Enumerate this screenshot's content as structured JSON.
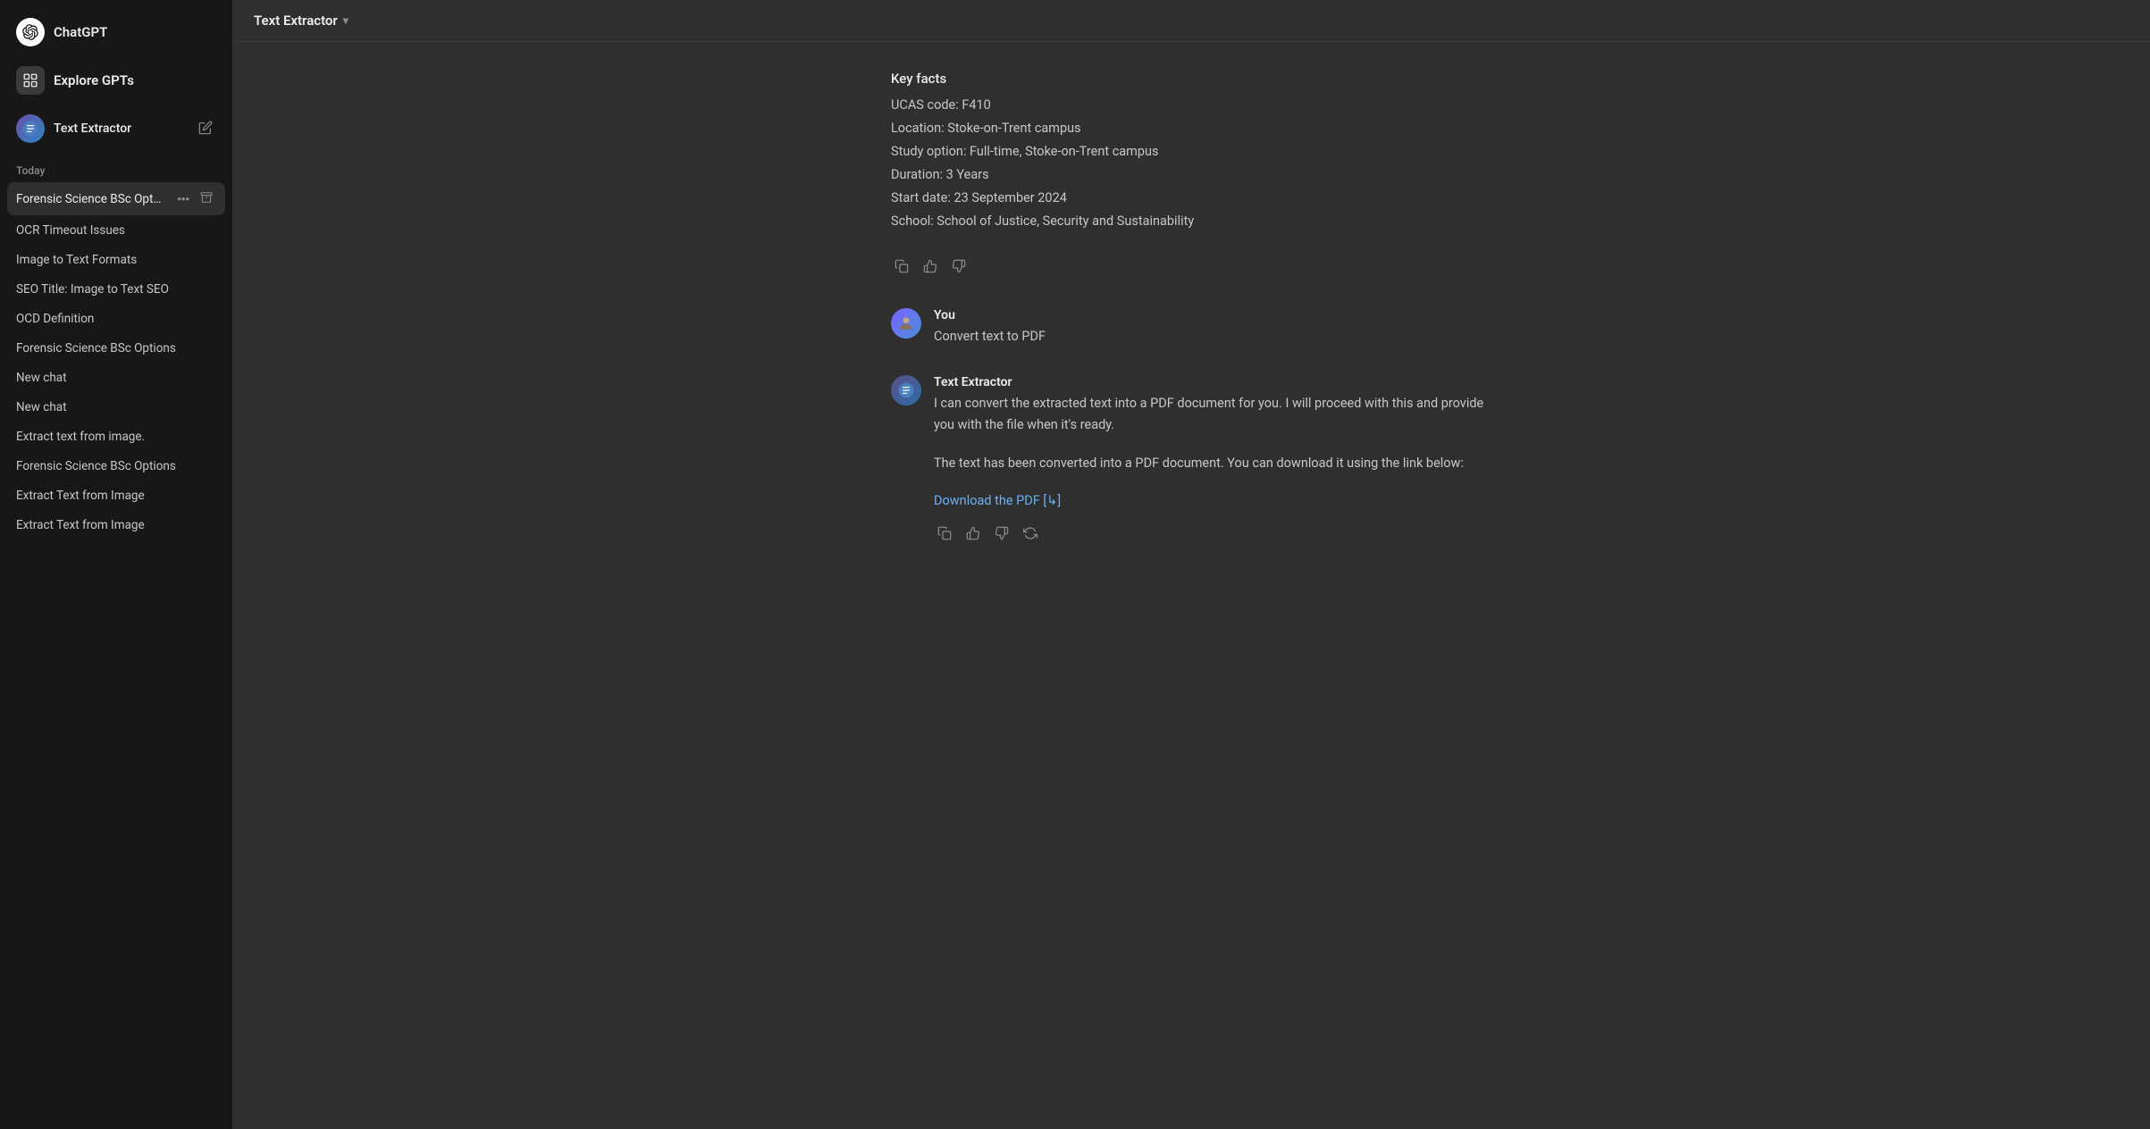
{
  "sidebar": {
    "app_name": "ChatGPT",
    "gpt_label": "Explore GPTs",
    "text_extractor_name": "Text Extractor",
    "edit_icon": "✏",
    "section_today": "Today",
    "chat_items": [
      {
        "id": "forensic-active",
        "label": "Forensic Science BSc Opt…",
        "active": true,
        "show_actions": true
      },
      {
        "id": "ocr-timeout",
        "label": "OCR Timeout Issues",
        "active": false,
        "show_actions": false
      },
      {
        "id": "image-to-text",
        "label": "Image to Text Formats",
        "active": false,
        "show_actions": false
      },
      {
        "id": "seo-title",
        "label": "SEO Title: Image to Text SEO",
        "active": false,
        "show_actions": false
      },
      {
        "id": "ocd-def",
        "label": "OCD Definition",
        "active": false,
        "show_actions": false
      },
      {
        "id": "forensic-bsc-1",
        "label": "Forensic Science BSc Options",
        "active": false,
        "show_actions": false
      },
      {
        "id": "new-chat-1",
        "label": "New chat",
        "active": false,
        "show_actions": false
      },
      {
        "id": "new-chat-2",
        "label": "New chat",
        "active": false,
        "show_actions": false
      },
      {
        "id": "extract-text-1",
        "label": "Extract text from image.",
        "active": false,
        "show_actions": false
      },
      {
        "id": "forensic-bsc-2",
        "label": "Forensic Science BSc Options",
        "active": false,
        "show_actions": false
      },
      {
        "id": "extract-text-2",
        "label": "Extract Text from Image",
        "active": false,
        "show_actions": false
      },
      {
        "id": "extract-text-3",
        "label": "Extract Text from Image",
        "active": false,
        "show_actions": false
      }
    ]
  },
  "header": {
    "title": "Text Extractor",
    "chevron": "▾"
  },
  "conversation": {
    "key_facts": {
      "title": "Key facts",
      "items": [
        "UCAS code: F410",
        "Location: Stoke-on-Trent campus",
        "Study option: Full-time, Stoke-on-Trent campus",
        "Duration: 3 Years",
        "Start date: 23 September 2024",
        "School: School of Justice, Security and Sustainability"
      ]
    },
    "user_message": {
      "sender": "You",
      "text": "Convert text to PDF"
    },
    "assistant_message": {
      "sender": "Text Extractor",
      "paragraph1": "I can convert the extracted text into a PDF document for you. I will proceed with this and provide you with the file when it's ready.",
      "paragraph2": "The text has been converted into a PDF document. You can download it using the link below:",
      "download_link_text": "Download the PDF [↳]"
    }
  },
  "icons": {
    "copy": "⎘",
    "thumbs_up": "👍",
    "thumbs_down": "👎",
    "refresh": "↻",
    "more": "•••",
    "archive": "⊡",
    "edit_pencil": "✏"
  }
}
